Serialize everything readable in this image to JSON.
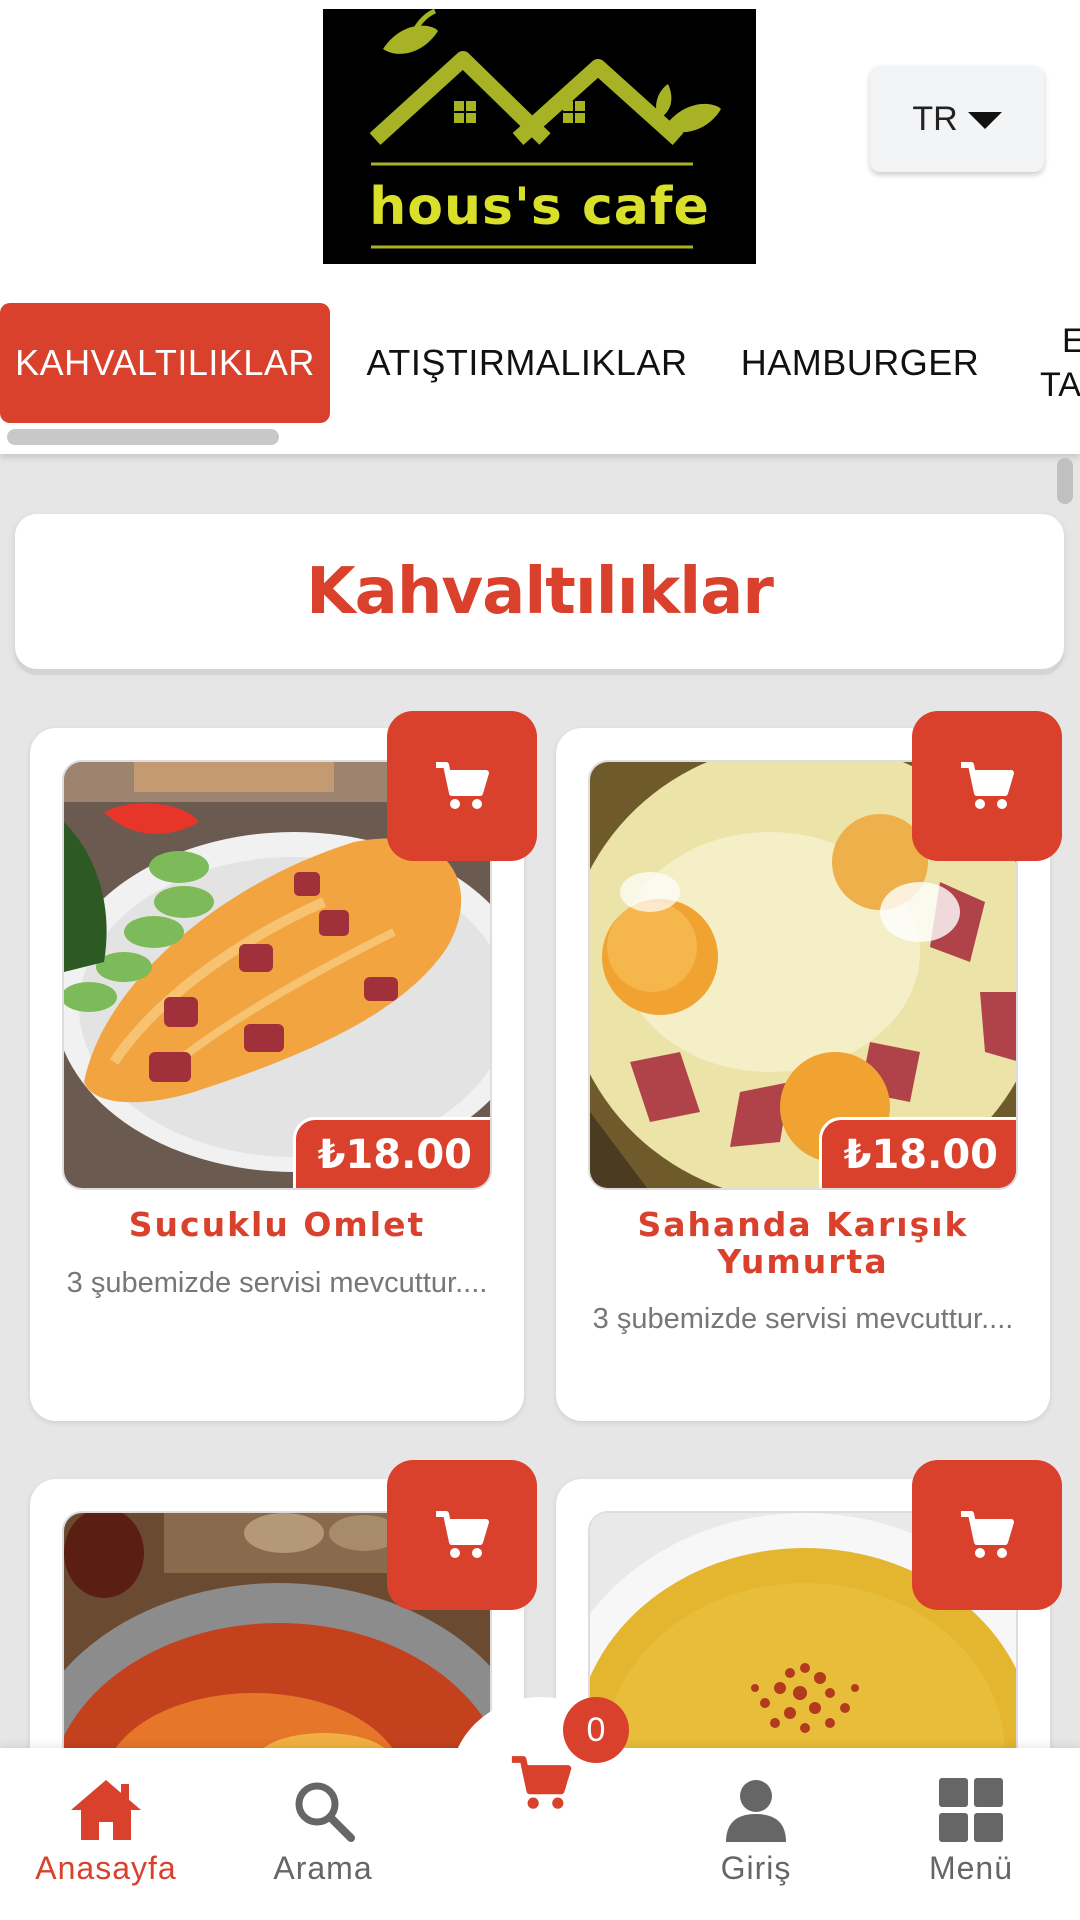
{
  "header": {
    "logo_text": "hous's cafe",
    "language": "TR"
  },
  "categories": [
    {
      "label": "KAHVALTILIKLAR",
      "active": true
    },
    {
      "label": "ATIŞTIRMALIKLAR",
      "active": false
    },
    {
      "label": "HAMBURGER",
      "active": false
    },
    {
      "label": "E\nTA",
      "active": false
    }
  ],
  "section": {
    "title": "Kahvaltılıklar"
  },
  "products": [
    {
      "name": "Sucuklu Omlet",
      "price": "₺18.00",
      "description": "3 şubemizde servisi mevcuttur...."
    },
    {
      "name": "Sahanda Karışık Yumurta",
      "price": "₺18.00",
      "description": "3 şubemizde servisi mevcuttur...."
    },
    {
      "name": "",
      "price": "",
      "description": ""
    },
    {
      "name": "",
      "price": "",
      "description": ""
    }
  ],
  "bottom_nav": {
    "home": "Anasayfa",
    "search": "Arama",
    "cart_count": "0",
    "login": "Giriş",
    "menu": "Menü"
  },
  "colors": {
    "accent": "#d9412c",
    "logo_green": "#a7b324",
    "background": "#e6e6e6",
    "nav_inactive": "#666666"
  },
  "icons": [
    "cart-icon",
    "home-icon",
    "search-icon",
    "user-icon",
    "grid-icon",
    "caret-down-icon"
  ]
}
